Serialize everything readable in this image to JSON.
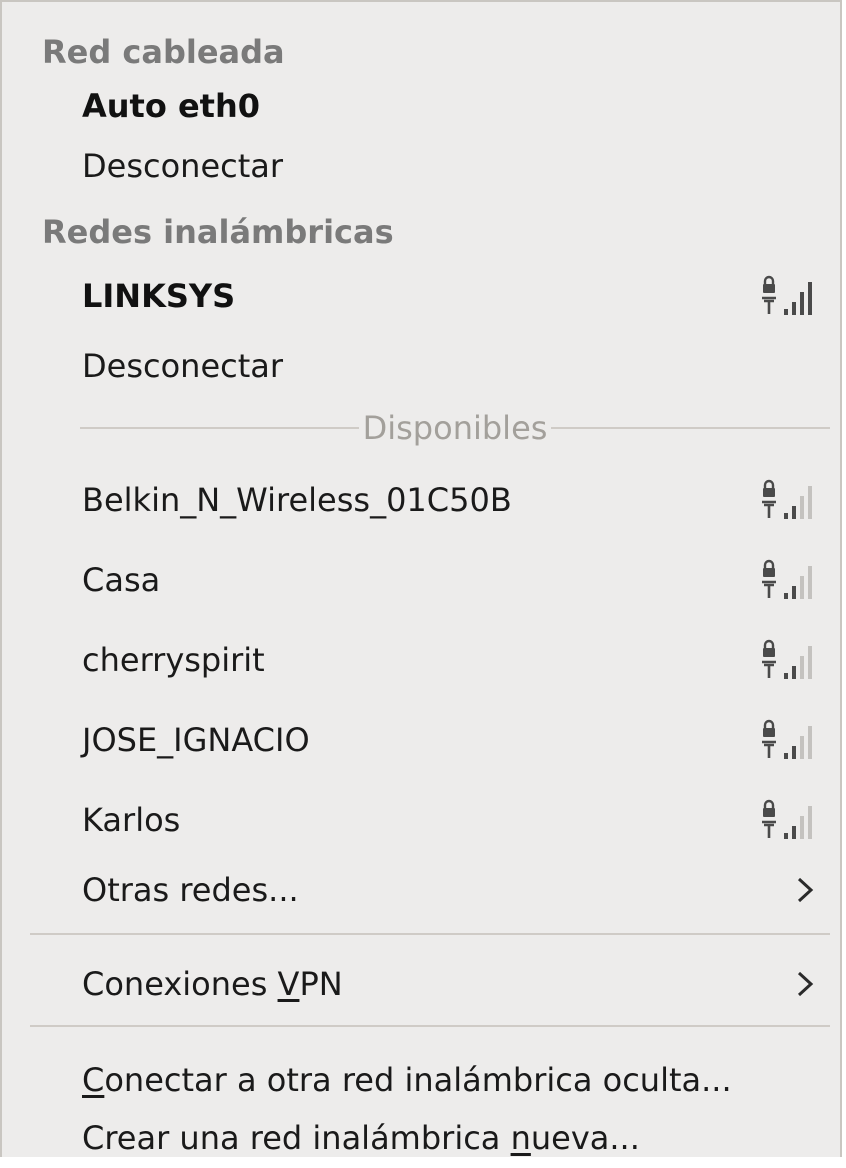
{
  "menu": {
    "wired_header": "Red cableada",
    "wired_connection": "Auto eth0",
    "wired_disconnect": "Desconectar",
    "wireless_header": "Redes inalámbricas",
    "active_network": {
      "name": "LINKSYS",
      "icon": "secure-signal-full-icon",
      "signal_bars": 4
    },
    "wireless_disconnect": "Desconectar",
    "available_label": "Disponibles",
    "available_networks": [
      {
        "name": "Belkin_N_Wireless_01C50B",
        "icon": "secure-signal-low-icon",
        "signal_bars": 2
      },
      {
        "name": "Casa",
        "icon": "secure-signal-low-icon",
        "signal_bars": 2
      },
      {
        "name": "cherryspirit",
        "icon": "secure-signal-low-icon",
        "signal_bars": 2
      },
      {
        "name": "JOSE_IGNACIO",
        "icon": "secure-signal-low-icon",
        "signal_bars": 2
      },
      {
        "name": "Karlos",
        "icon": "secure-signal-low-icon",
        "signal_bars": 2
      }
    ],
    "other_networks": "Otras redes...",
    "vpn": {
      "before": "Conexiones ",
      "mnemonic": "V",
      "after": "PN"
    },
    "hidden_network": {
      "before": "",
      "mnemonic": "C",
      "after": "onectar a otra red inalámbrica oculta..."
    },
    "new_network": {
      "before": "Crear una red inalámbrica ",
      "mnemonic": "n",
      "after": "ueva..."
    },
    "colors": {
      "background": "#edeceb",
      "header_text": "#7a7a7a",
      "separator": "#cfcbc6",
      "icon_dark": "#4a4a4a",
      "icon_faded": "#c4c2bf"
    }
  }
}
